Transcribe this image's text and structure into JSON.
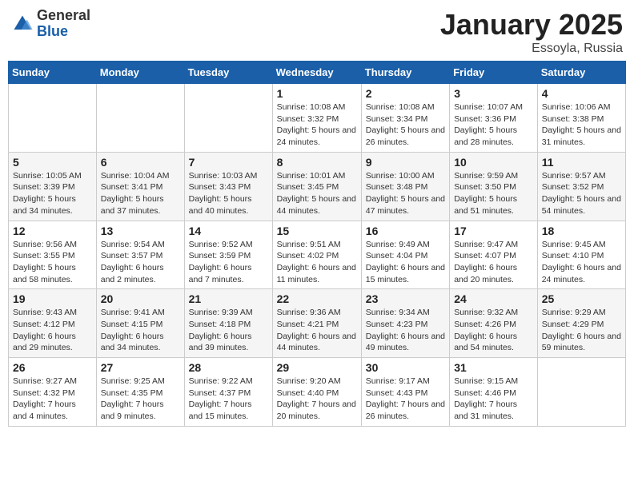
{
  "header": {
    "logo_general": "General",
    "logo_blue": "Blue",
    "month_title": "January 2025",
    "location": "Essoyla, Russia"
  },
  "weekdays": [
    "Sunday",
    "Monday",
    "Tuesday",
    "Wednesday",
    "Thursday",
    "Friday",
    "Saturday"
  ],
  "weeks": [
    [
      {
        "day": "",
        "info": ""
      },
      {
        "day": "",
        "info": ""
      },
      {
        "day": "",
        "info": ""
      },
      {
        "day": "1",
        "info": "Sunrise: 10:08 AM\nSunset: 3:32 PM\nDaylight: 5 hours and 24 minutes."
      },
      {
        "day": "2",
        "info": "Sunrise: 10:08 AM\nSunset: 3:34 PM\nDaylight: 5 hours and 26 minutes."
      },
      {
        "day": "3",
        "info": "Sunrise: 10:07 AM\nSunset: 3:36 PM\nDaylight: 5 hours and 28 minutes."
      },
      {
        "day": "4",
        "info": "Sunrise: 10:06 AM\nSunset: 3:38 PM\nDaylight: 5 hours and 31 minutes."
      }
    ],
    [
      {
        "day": "5",
        "info": "Sunrise: 10:05 AM\nSunset: 3:39 PM\nDaylight: 5 hours and 34 minutes."
      },
      {
        "day": "6",
        "info": "Sunrise: 10:04 AM\nSunset: 3:41 PM\nDaylight: 5 hours and 37 minutes."
      },
      {
        "day": "7",
        "info": "Sunrise: 10:03 AM\nSunset: 3:43 PM\nDaylight: 5 hours and 40 minutes."
      },
      {
        "day": "8",
        "info": "Sunrise: 10:01 AM\nSunset: 3:45 PM\nDaylight: 5 hours and 44 minutes."
      },
      {
        "day": "9",
        "info": "Sunrise: 10:00 AM\nSunset: 3:48 PM\nDaylight: 5 hours and 47 minutes."
      },
      {
        "day": "10",
        "info": "Sunrise: 9:59 AM\nSunset: 3:50 PM\nDaylight: 5 hours and 51 minutes."
      },
      {
        "day": "11",
        "info": "Sunrise: 9:57 AM\nSunset: 3:52 PM\nDaylight: 5 hours and 54 minutes."
      }
    ],
    [
      {
        "day": "12",
        "info": "Sunrise: 9:56 AM\nSunset: 3:55 PM\nDaylight: 5 hours and 58 minutes."
      },
      {
        "day": "13",
        "info": "Sunrise: 9:54 AM\nSunset: 3:57 PM\nDaylight: 6 hours and 2 minutes."
      },
      {
        "day": "14",
        "info": "Sunrise: 9:52 AM\nSunset: 3:59 PM\nDaylight: 6 hours and 7 minutes."
      },
      {
        "day": "15",
        "info": "Sunrise: 9:51 AM\nSunset: 4:02 PM\nDaylight: 6 hours and 11 minutes."
      },
      {
        "day": "16",
        "info": "Sunrise: 9:49 AM\nSunset: 4:04 PM\nDaylight: 6 hours and 15 minutes."
      },
      {
        "day": "17",
        "info": "Sunrise: 9:47 AM\nSunset: 4:07 PM\nDaylight: 6 hours and 20 minutes."
      },
      {
        "day": "18",
        "info": "Sunrise: 9:45 AM\nSunset: 4:10 PM\nDaylight: 6 hours and 24 minutes."
      }
    ],
    [
      {
        "day": "19",
        "info": "Sunrise: 9:43 AM\nSunset: 4:12 PM\nDaylight: 6 hours and 29 minutes."
      },
      {
        "day": "20",
        "info": "Sunrise: 9:41 AM\nSunset: 4:15 PM\nDaylight: 6 hours and 34 minutes."
      },
      {
        "day": "21",
        "info": "Sunrise: 9:39 AM\nSunset: 4:18 PM\nDaylight: 6 hours and 39 minutes."
      },
      {
        "day": "22",
        "info": "Sunrise: 9:36 AM\nSunset: 4:21 PM\nDaylight: 6 hours and 44 minutes."
      },
      {
        "day": "23",
        "info": "Sunrise: 9:34 AM\nSunset: 4:23 PM\nDaylight: 6 hours and 49 minutes."
      },
      {
        "day": "24",
        "info": "Sunrise: 9:32 AM\nSunset: 4:26 PM\nDaylight: 6 hours and 54 minutes."
      },
      {
        "day": "25",
        "info": "Sunrise: 9:29 AM\nSunset: 4:29 PM\nDaylight: 6 hours and 59 minutes."
      }
    ],
    [
      {
        "day": "26",
        "info": "Sunrise: 9:27 AM\nSunset: 4:32 PM\nDaylight: 7 hours and 4 minutes."
      },
      {
        "day": "27",
        "info": "Sunrise: 9:25 AM\nSunset: 4:35 PM\nDaylight: 7 hours and 9 minutes."
      },
      {
        "day": "28",
        "info": "Sunrise: 9:22 AM\nSunset: 4:37 PM\nDaylight: 7 hours and 15 minutes."
      },
      {
        "day": "29",
        "info": "Sunrise: 9:20 AM\nSunset: 4:40 PM\nDaylight: 7 hours and 20 minutes."
      },
      {
        "day": "30",
        "info": "Sunrise: 9:17 AM\nSunset: 4:43 PM\nDaylight: 7 hours and 26 minutes."
      },
      {
        "day": "31",
        "info": "Sunrise: 9:15 AM\nSunset: 4:46 PM\nDaylight: 7 hours and 31 minutes."
      },
      {
        "day": "",
        "info": ""
      }
    ]
  ]
}
